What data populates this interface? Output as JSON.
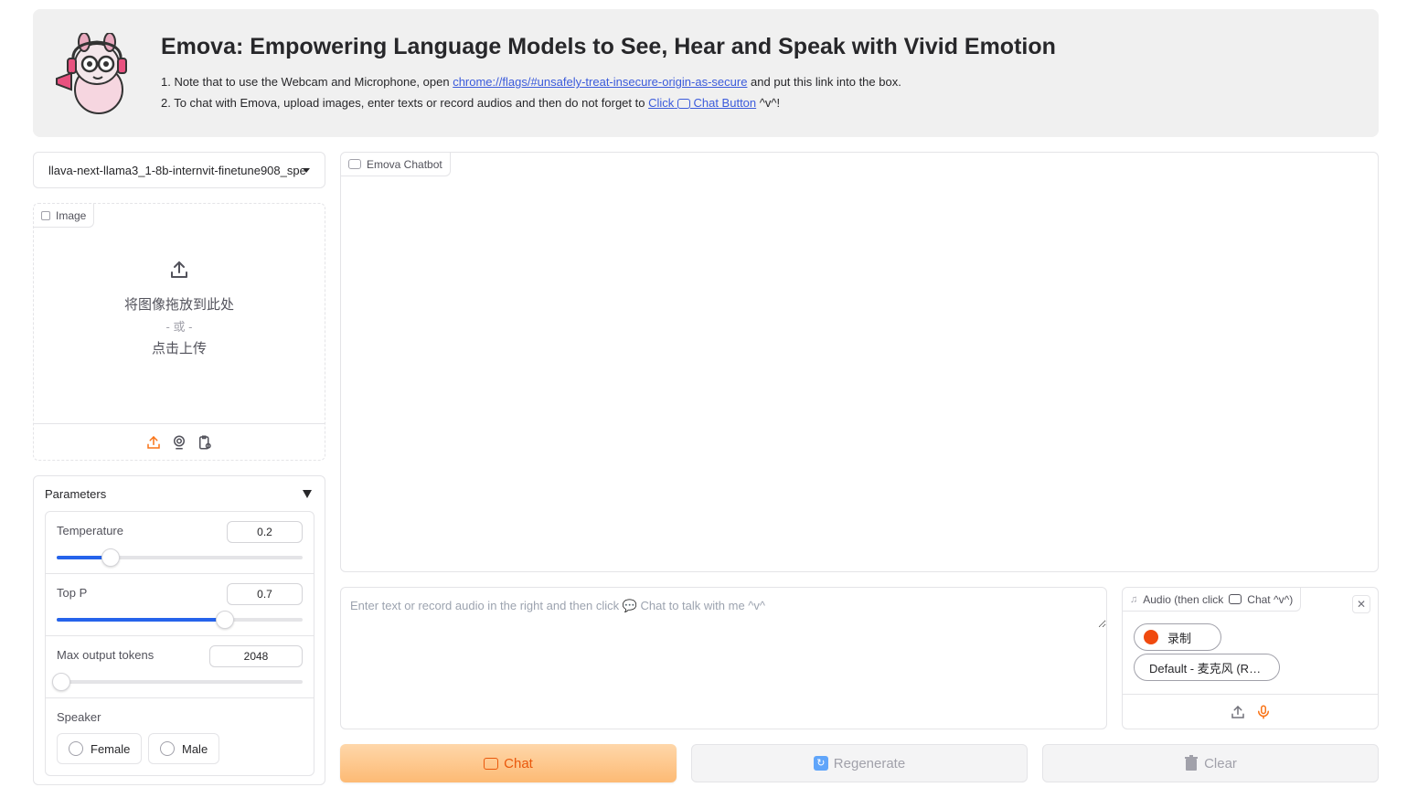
{
  "header": {
    "title": "Emova: Empowering Language Models to See, Hear and Speak with Vivid Emotion",
    "note1_prefix": "1. Note that to use the Webcam and Microphone, open ",
    "note1_link": "chrome://flags/#unsafely-treat-insecure-origin-as-secure",
    "note1_suffix": " and put this link into the box.",
    "note2_prefix": "2. To chat with Emova, upload images, enter texts or record audios and then do not forget to ",
    "note2_link_click": "Click",
    "note2_link_button": " Chat Button",
    "note2_suffix": " ^v^!"
  },
  "model_select": {
    "value": "llava-next-llama3_1-8b-internvit-finetune908_spe"
  },
  "image_upload": {
    "label": "Image",
    "drop_text": "将图像拖放到此处",
    "or_text": "- 或 -",
    "click_text": "点击上传"
  },
  "parameters": {
    "title": "Parameters",
    "temperature": {
      "label": "Temperature",
      "value": "0.2",
      "fraction": 0.22
    },
    "top_p": {
      "label": "Top P",
      "value": "0.7",
      "fraction": 0.685
    },
    "max_tokens": {
      "label": "Max output tokens",
      "value": "2048",
      "fraction": 0.02
    },
    "speaker": {
      "label": "Speaker",
      "options": [
        "Female",
        "Male"
      ]
    }
  },
  "chatbot": {
    "label": "Emova Chatbot"
  },
  "textbox": {
    "placeholder": "Enter text or record audio in the right and then click 💬 Chat to talk with me ^v^"
  },
  "audio": {
    "label_prefix": "Audio (then click ",
    "label_suffix": " Chat ^v^)",
    "record_label": "录制",
    "mic_device": "Default - 麦克风 (R…"
  },
  "buttons": {
    "chat": "Chat",
    "regenerate": "Regenerate",
    "clear": "Clear"
  },
  "colors": {
    "accent": "#f97316",
    "link": "#3b5bdb",
    "slider": "#2563eb",
    "record": "#f04a0f"
  }
}
